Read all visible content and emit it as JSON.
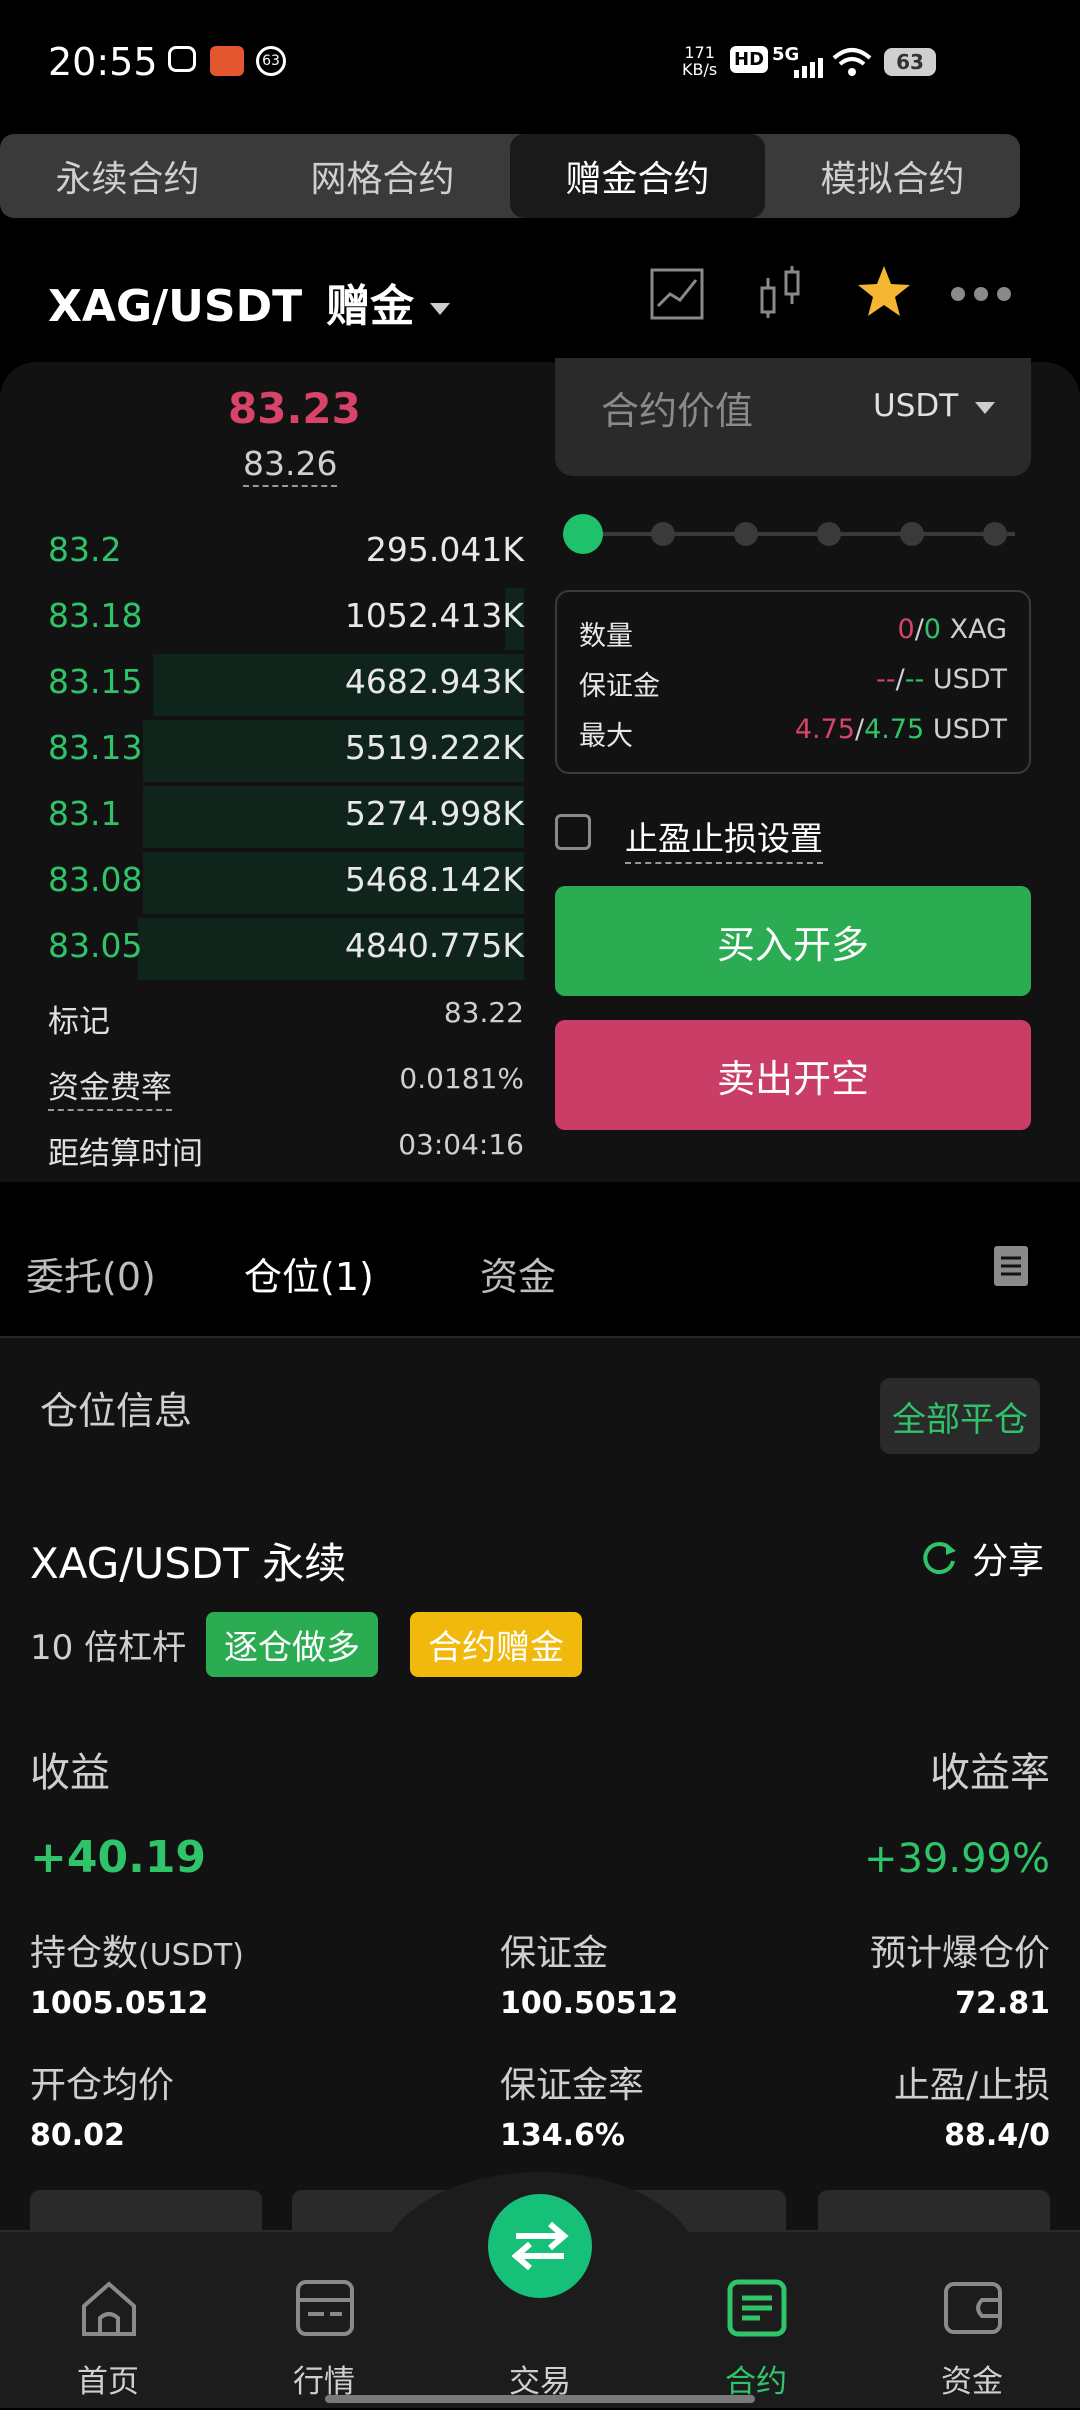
{
  "status_bar": {
    "time": "20:55",
    "net_speed_top": "171",
    "net_speed_unit": "KB/s",
    "hd": "HD",
    "signal": "5G",
    "battery": "63",
    "notif_count": "63"
  },
  "contract_tabs": [
    {
      "label": "永续合约",
      "active": false
    },
    {
      "label": "网格合约",
      "active": false
    },
    {
      "label": "赠金合约",
      "active": true
    },
    {
      "label": "模拟合约",
      "active": false
    }
  ],
  "pair": {
    "symbol": "XAG/USDT",
    "tag": "赠金"
  },
  "orderbook": {
    "last_price": "83.23",
    "index_price": "83.26",
    "bids": [
      {
        "price": "83.2",
        "qty": "295.041K",
        "depth": 0.0
      },
      {
        "price": "83.18",
        "qty": "1052.413K",
        "depth": 0.04
      },
      {
        "price": "83.15",
        "qty": "4682.943K",
        "depth": 0.78
      },
      {
        "price": "83.13",
        "qty": "5519.222K",
        "depth": 0.8
      },
      {
        "price": "83.1",
        "qty": "5274.998K",
        "depth": 0.8
      },
      {
        "price": "83.08",
        "qty": "5468.142K",
        "depth": 0.8
      },
      {
        "price": "83.05",
        "qty": "4840.775K",
        "depth": 0.81
      }
    ],
    "mark_label": "标记",
    "mark_value": "83.22",
    "funding_label": "资金费率",
    "funding_value": "0.0181%",
    "settle_label": "距结算时间",
    "settle_value": "03:04:16"
  },
  "order_form": {
    "value_placeholder": "合约价值",
    "unit": "USDT",
    "qty_label": "数量",
    "qty_a": "0",
    "qty_b": "0",
    "qty_unit": "XAG",
    "margin_label": "保证金",
    "margin_a": "--",
    "margin_b": "--",
    "margin_unit": "USDT",
    "max_label": "最大",
    "max_a": "4.75",
    "max_b": "4.75",
    "max_unit": "USDT",
    "tpsl_label": "止盈止损设置",
    "buy_label": "买入开多",
    "sell_label": "卖出开空"
  },
  "list_tabs": {
    "orders": "委托(0)",
    "positions": "仓位(1)",
    "funds": "资金"
  },
  "position": {
    "section_title": "仓位信息",
    "close_all": "全部平仓",
    "symbol": "XAG/USDT 永续",
    "share": "分享",
    "leverage": "10 倍杠杆",
    "badge_mode": "逐仓做多",
    "badge_bonus": "合约赠金",
    "pnl_label": "收益",
    "roe_label": "收益率",
    "pnl_value": "+40.19",
    "roe_value": "+39.99%",
    "size_label": "持仓数",
    "size_unit": "(USDT)",
    "size_value": "1005.0512",
    "margin_label": "保证金",
    "margin_value": "100.50512",
    "liq_label": "预计爆仓价",
    "liq_value": "72.81",
    "entry_label": "开仓均价",
    "entry_value": "80.02",
    "margin_rate_label": "保证金率",
    "margin_rate_value": "134.6%",
    "tpsl_label": "止盈/止损",
    "tpsl_value": "88.4/0"
  },
  "bottom_nav": [
    {
      "label": "首页",
      "icon": "home-icon"
    },
    {
      "label": "行情",
      "icon": "market-icon"
    },
    {
      "label": "交易",
      "icon": "swap-icon"
    },
    {
      "label": "合约",
      "icon": "contract-icon",
      "active": true
    },
    {
      "label": "资金",
      "icon": "wallet-icon"
    }
  ],
  "colors": {
    "green": "#2fc36a",
    "red": "#d8436a",
    "buy": "#2bab52",
    "sell": "#c93d66",
    "badge_green": "#2bab52",
    "badge_yellow": "#f0b90b"
  }
}
